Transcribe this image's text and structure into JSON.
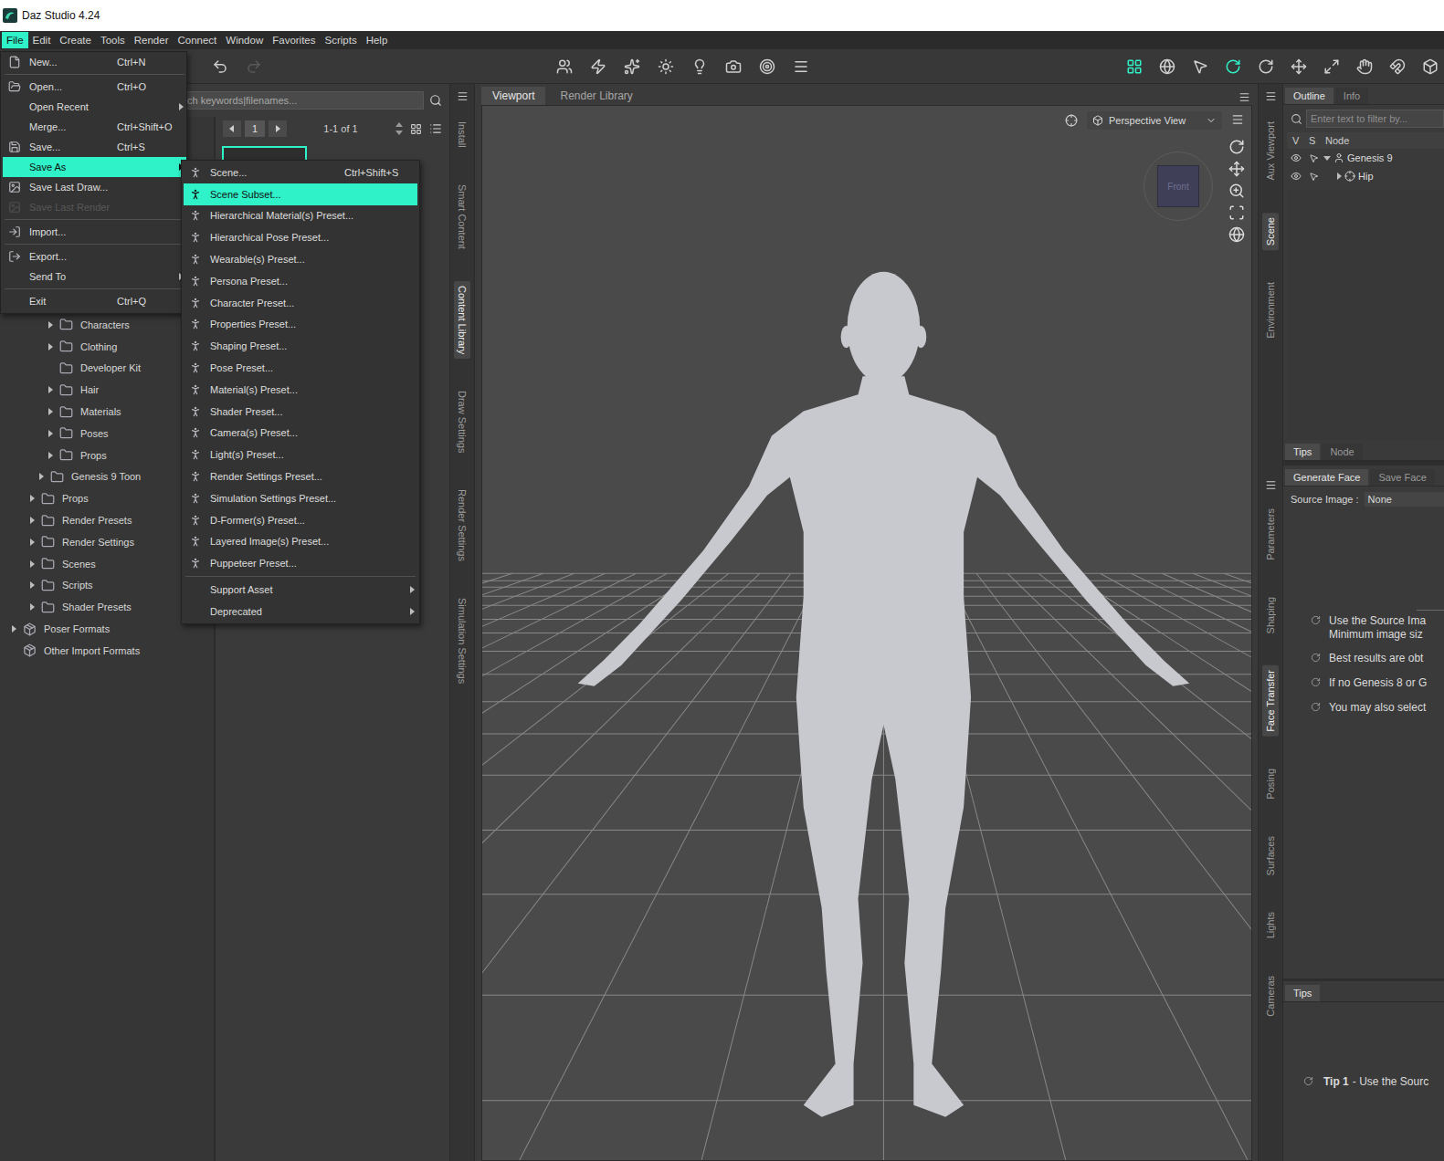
{
  "window": {
    "title": "Daz Studio 4.24"
  },
  "menubar": [
    {
      "label": "File",
      "selected": true
    },
    {
      "label": "Edit",
      "selected": false
    },
    {
      "label": "Create",
      "selected": false
    },
    {
      "label": "Tools",
      "selected": false
    },
    {
      "label": "Render",
      "selected": false
    },
    {
      "label": "Connect",
      "selected": false
    },
    {
      "label": "Window",
      "selected": false
    },
    {
      "label": "Favorites",
      "selected": false
    },
    {
      "label": "Scripts",
      "selected": false
    },
    {
      "label": "Help",
      "selected": false
    }
  ],
  "history": [
    {
      "disabled": false
    },
    {
      "disabled": true
    }
  ],
  "tools": [
    {
      "selected": true
    },
    {
      "selected": false
    },
    {
      "selected": false
    },
    {
      "selected": true
    },
    {
      "selected": false
    },
    {
      "selected": false
    },
    {
      "selected": false
    },
    {
      "selected": false
    },
    {
      "selected": false
    },
    {
      "selected": false
    }
  ],
  "file_menu": [
    {
      "kind": "item",
      "label": "New...",
      "shortcut": "Ctrl+N",
      "selected": false,
      "disabled": false,
      "submenu": false
    },
    {
      "kind": "separator"
    },
    {
      "kind": "item",
      "label": "Open...",
      "shortcut": "Ctrl+O",
      "selected": false,
      "disabled": false,
      "submenu": false
    },
    {
      "kind": "item",
      "label": "Open Recent",
      "shortcut": "",
      "selected": false,
      "disabled": false,
      "submenu": true
    },
    {
      "kind": "item",
      "label": "Merge...",
      "shortcut": "Ctrl+Shift+O",
      "selected": false,
      "disabled": false,
      "submenu": false
    },
    {
      "kind": "item",
      "label": "Save...",
      "shortcut": "Ctrl+S",
      "selected": false,
      "disabled": false,
      "submenu": false
    },
    {
      "kind": "item",
      "label": "Save As",
      "shortcut": "",
      "selected": true,
      "disabled": false,
      "submenu": true
    },
    {
      "kind": "item",
      "label": "Save Last Draw...",
      "shortcut": "",
      "selected": false,
      "disabled": false,
      "submenu": false
    },
    {
      "kind": "item",
      "label": "Save Last Render",
      "shortcut": "",
      "selected": false,
      "disabled": true,
      "submenu": false
    },
    {
      "kind": "separator"
    },
    {
      "kind": "item",
      "label": "Import...",
      "shortcut": "",
      "selected": false,
      "disabled": false,
      "submenu": false
    },
    {
      "kind": "separator"
    },
    {
      "kind": "item",
      "label": "Export...",
      "shortcut": "",
      "selected": false,
      "disabled": false,
      "submenu": false
    },
    {
      "kind": "item",
      "label": "Send To",
      "shortcut": "",
      "selected": false,
      "disabled": false,
      "submenu": true
    },
    {
      "kind": "separator"
    },
    {
      "kind": "item",
      "label": "Exit",
      "shortcut": "Ctrl+Q",
      "selected": false,
      "disabled": false,
      "submenu": false
    }
  ],
  "save_as_menu": [
    {
      "kind": "item",
      "label": "Scene...",
      "shortcut": "Ctrl+Shift+S",
      "selected": false,
      "submenu": false
    },
    {
      "kind": "item",
      "label": "Scene Subset...",
      "shortcut": "",
      "selected": true,
      "submenu": false
    },
    {
      "kind": "item",
      "label": "Hierarchical Material(s) Preset...",
      "shortcut": "",
      "selected": false,
      "submenu": false
    },
    {
      "kind": "item",
      "label": "Hierarchical Pose Preset...",
      "shortcut": "",
      "selected": false,
      "submenu": false
    },
    {
      "kind": "item",
      "label": "Wearable(s) Preset...",
      "shortcut": "",
      "selected": false,
      "submenu": false
    },
    {
      "kind": "item",
      "label": "Persona Preset...",
      "shortcut": "",
      "selected": false,
      "submenu": false
    },
    {
      "kind": "item",
      "label": "Character Preset...",
      "shortcut": "",
      "selected": false,
      "submenu": false
    },
    {
      "kind": "item",
      "label": "Properties Preset...",
      "shortcut": "",
      "selected": false,
      "submenu": false
    },
    {
      "kind": "item",
      "label": "Shaping Preset...",
      "shortcut": "",
      "selected": false,
      "submenu": false
    },
    {
      "kind": "item",
      "label": "Pose Preset...",
      "shortcut": "",
      "selected": false,
      "submenu": false
    },
    {
      "kind": "item",
      "label": "Material(s) Preset...",
      "shortcut": "",
      "selected": false,
      "submenu": false
    },
    {
      "kind": "item",
      "label": "Shader Preset...",
      "shortcut": "",
      "selected": false,
      "submenu": false
    },
    {
      "kind": "item",
      "label": "Camera(s) Preset...",
      "shortcut": "",
      "selected": false,
      "submenu": false
    },
    {
      "kind": "item",
      "label": "Light(s) Preset...",
      "shortcut": "",
      "selected": false,
      "submenu": false
    },
    {
      "kind": "item",
      "label": "Render Settings Preset...",
      "shortcut": "",
      "selected": false,
      "submenu": false
    },
    {
      "kind": "item",
      "label": "Simulation Settings Preset...",
      "shortcut": "",
      "selected": false,
      "submenu": false
    },
    {
      "kind": "item",
      "label": "D-Former(s) Preset...",
      "shortcut": "",
      "selected": false,
      "submenu": false
    },
    {
      "kind": "item",
      "label": "Layered Image(s) Preset...",
      "shortcut": "",
      "selected": false,
      "submenu": false
    },
    {
      "kind": "item",
      "label": "Puppeteer Preset...",
      "shortcut": "",
      "selected": false,
      "submenu": false
    },
    {
      "kind": "separator"
    },
    {
      "kind": "item",
      "label": "Support Asset",
      "shortcut": "",
      "selected": false,
      "submenu": true
    },
    {
      "kind": "item",
      "label": "Deprecated",
      "shortcut": "",
      "selected": false,
      "submenu": true
    }
  ],
  "content_library": {
    "search_placeholder": "ch keywords|filenames...",
    "page": "1",
    "range": "1-1 of 1",
    "thumbnails": [
      {
        "selected": true
      }
    ],
    "tree": [
      {
        "label": "Characters",
        "level": 4,
        "kind": "folder",
        "expandable": true,
        "expanded": false
      },
      {
        "label": "Clothing",
        "level": 4,
        "kind": "folder",
        "expandable": true,
        "expanded": false
      },
      {
        "label": "Developer Kit",
        "level": 4,
        "kind": "folder",
        "expandable": false,
        "expanded": false
      },
      {
        "label": "Hair",
        "level": 4,
        "kind": "folder",
        "expandable": true,
        "expanded": false
      },
      {
        "label": "Materials",
        "level": 4,
        "kind": "folder",
        "expandable": true,
        "expanded": false
      },
      {
        "label": "Poses",
        "level": 4,
        "kind": "folder",
        "expandable": true,
        "expanded": false
      },
      {
        "label": "Props",
        "level": 4,
        "kind": "folder",
        "expandable": true,
        "expanded": false
      },
      {
        "label": "Genesis 9 Toon",
        "level": 3,
        "kind": "folder",
        "expandable": true,
        "expanded": false
      },
      {
        "label": "Props",
        "level": 2,
        "kind": "folder",
        "expandable": true,
        "expanded": false
      },
      {
        "label": "Render Presets",
        "level": 2,
        "kind": "folder",
        "expandable": true,
        "expanded": false
      },
      {
        "label": "Render Settings",
        "level": 2,
        "kind": "folder",
        "expandable": true,
        "expanded": false
      },
      {
        "label": "Scenes",
        "level": 2,
        "kind": "folder",
        "expandable": true,
        "expanded": false
      },
      {
        "label": "Scripts",
        "level": 2,
        "kind": "folder",
        "expandable": true,
        "expanded": false
      },
      {
        "label": "Shader Presets",
        "level": 2,
        "kind": "folder",
        "expandable": true,
        "expanded": false
      },
      {
        "label": "Poser Formats",
        "level": 0,
        "kind": "package",
        "expandable": true,
        "expanded": false
      },
      {
        "label": "Other Import Formats",
        "level": 0,
        "kind": "package",
        "expandable": false,
        "expanded": false
      }
    ]
  },
  "left_tabs": [
    {
      "label": "Install",
      "selected": false
    },
    {
      "label": "Smart Content",
      "selected": false
    },
    {
      "label": "Content Library",
      "selected": true
    },
    {
      "label": "Draw Settings",
      "selected": false
    },
    {
      "label": "Render Settings",
      "selected": false
    },
    {
      "label": "Simulation Settings",
      "selected": false
    }
  ],
  "viewport": {
    "tabs": [
      {
        "label": "Viewport",
        "selected": true
      },
      {
        "label": "Render Library",
        "selected": false
      }
    ],
    "view": "Perspective View",
    "navcube": "Front"
  },
  "right_tabs_upper": [
    {
      "label": "Aux Viewport",
      "selected": false
    },
    {
      "label": "Scene",
      "selected": true
    },
    {
      "label": "Environment",
      "selected": false
    }
  ],
  "right_tabs_lower": [
    {
      "label": "Parameters",
      "selected": false
    },
    {
      "label": "Shaping",
      "selected": false
    },
    {
      "label": "Face Transfer",
      "selected": true
    },
    {
      "label": "Posing",
      "selected": false
    },
    {
      "label": "Surfaces",
      "selected": false
    },
    {
      "label": "Lights",
      "selected": false
    },
    {
      "label": "Cameras",
      "selected": false
    }
  ],
  "scene": {
    "tabs": [
      {
        "label": "Outline",
        "selected": true
      },
      {
        "label": "Info",
        "selected": false
      }
    ],
    "filter_placeholder": "Enter text to filter by...",
    "columns": [
      "V",
      "S",
      "Node"
    ],
    "rows": [
      {
        "label": "Genesis 9",
        "level": 0,
        "kind": "figure",
        "expanded": true,
        "visible": true,
        "selected": false
      },
      {
        "label": "Hip",
        "level": 1,
        "kind": "bone",
        "expanded": false,
        "visible": true,
        "selected": false
      }
    ]
  },
  "info_tabs": [
    {
      "label": "Tips",
      "selected": true
    },
    {
      "label": "Node",
      "selected": false
    }
  ],
  "face_transfer": {
    "tabs": [
      {
        "label": "Generate Face",
        "selected": true
      },
      {
        "label": "Save Face",
        "selected": false
      }
    ],
    "source_label": "Source Image :",
    "source_value": "None",
    "tips": [
      {
        "lines": [
          "Use the Source Ima",
          "Minimum image siz"
        ]
      },
      {
        "lines": [
          "Best results are obt"
        ]
      },
      {
        "lines": [
          "If no Genesis 8 or G"
        ]
      },
      {
        "lines": [
          "You may also select"
        ]
      }
    ]
  },
  "tips_pane": {
    "tabs": [
      {
        "label": "Tips",
        "selected": true
      }
    ],
    "tip_label": "Tip 1",
    "tip_text": "- Use the Sourc"
  }
}
